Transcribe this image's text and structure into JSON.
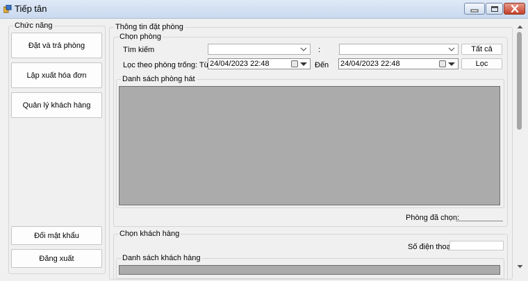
{
  "window": {
    "title": "Tiếp tân",
    "minimize_icon": "minimize-icon",
    "maximize_icon": "maximize-icon",
    "close_icon": "close-icon"
  },
  "sidebar": {
    "group_label": "Chức năng",
    "top_buttons": [
      "Đặt và trả phòng",
      "Lập xuất hóa đơn",
      "Quản lý khách hàng"
    ],
    "bottom_buttons": [
      "Đổi mật khẩu",
      "Đăng xuất"
    ]
  },
  "booking": {
    "group_label": "Thông tin đặt phòng",
    "room_select": {
      "group_label": "Chọn phòng",
      "search_label": "Tìm kiếm",
      "search_value_1": "",
      "separator": ":",
      "search_value_2": "",
      "all_button": "Tất cả",
      "filter_label": "Lọc theo phòng trống: Từ",
      "from_date": "24/04/2023 22:48",
      "to_label": "Đến",
      "to_date": "24/04/2023 22:48",
      "filter_button": "Lọc",
      "list_label": "Danh sách phòng hát",
      "selected_label": "Phòng đã chọn:",
      "selected_value": ""
    },
    "customer_select": {
      "group_label": "Chọn khách hàng",
      "phone_label": "Số điện thoại",
      "phone_value": "",
      "list_label": "Danh sách khách hàng"
    }
  },
  "colors": {
    "grid_bg": "#ababab",
    "form_bg": "#f0f0f0",
    "close_btn": "#c5402a"
  }
}
